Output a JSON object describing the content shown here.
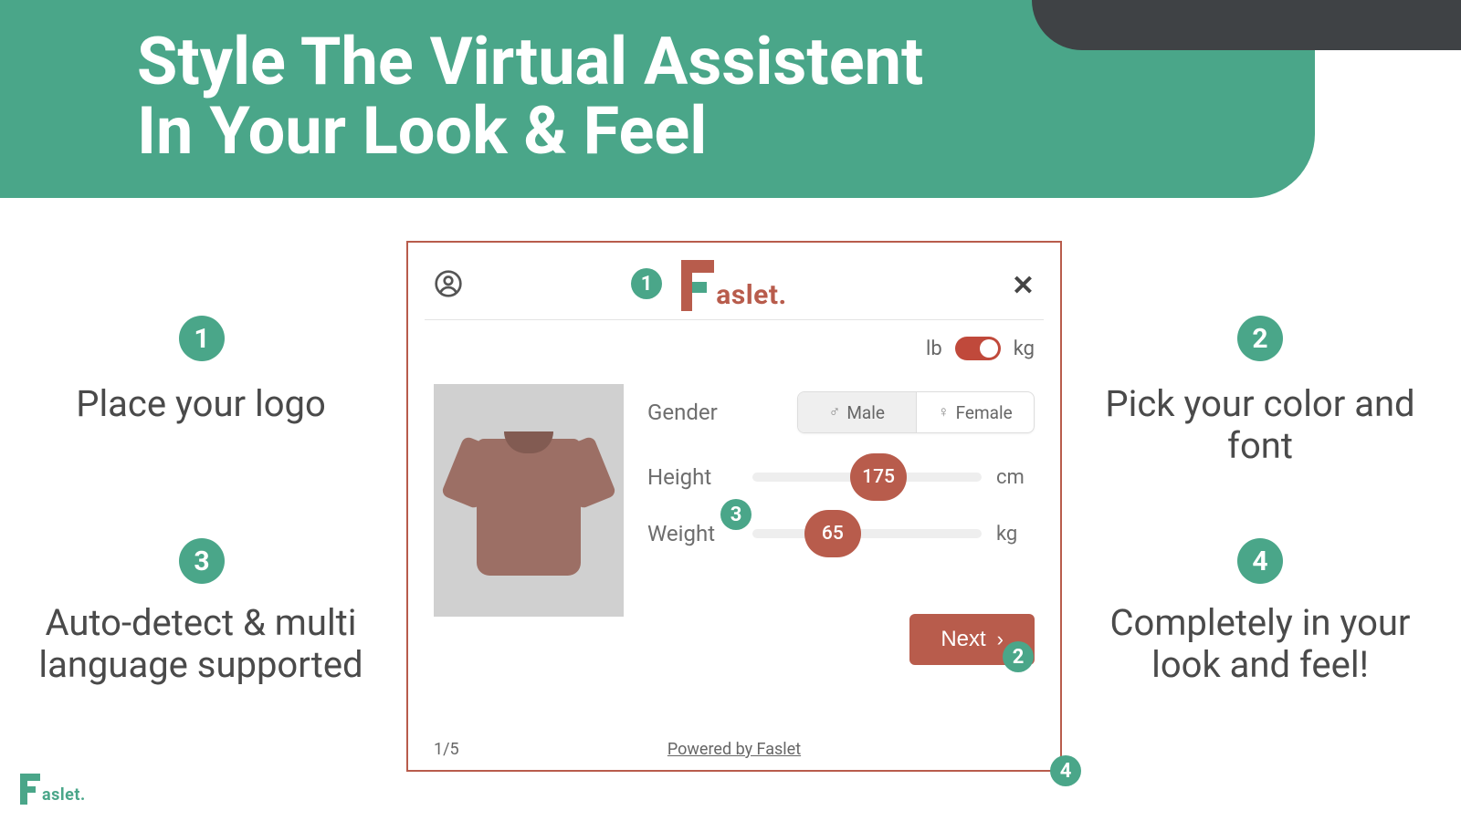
{
  "header": {
    "title_line1": "Style The Virtual Assistent",
    "title_line2": "In Your Look & Feel"
  },
  "annotations": {
    "a1": {
      "num": "1",
      "text": "Place your logo"
    },
    "a2": {
      "num": "2",
      "text": "Pick your color and font"
    },
    "a3": {
      "num": "3",
      "text": "Auto-detect & multi language supported"
    },
    "a4": {
      "num": "4",
      "text": "Completely in your look and feel!"
    }
  },
  "inline_badges": {
    "b1": "1",
    "b2": "2",
    "b3": "3",
    "b4": "4"
  },
  "widget": {
    "logo_text": "aslet.",
    "units": {
      "left": "lb",
      "right": "kg",
      "active": "kg"
    },
    "gender": {
      "label": "Gender",
      "male": "Male",
      "female": "Female",
      "selected": "Male"
    },
    "height": {
      "label": "Height",
      "value": "175",
      "unit": "cm",
      "percent": 55
    },
    "weight": {
      "label": "Weight",
      "value": "65",
      "unit": "kg",
      "percent": 35
    },
    "next": "Next",
    "page": "1/5",
    "powered": "Powered by Faslet"
  },
  "mini_logo_text": "aslet.",
  "colors": {
    "accent_green": "#4aa689",
    "accent_red": "#b85c4c"
  }
}
